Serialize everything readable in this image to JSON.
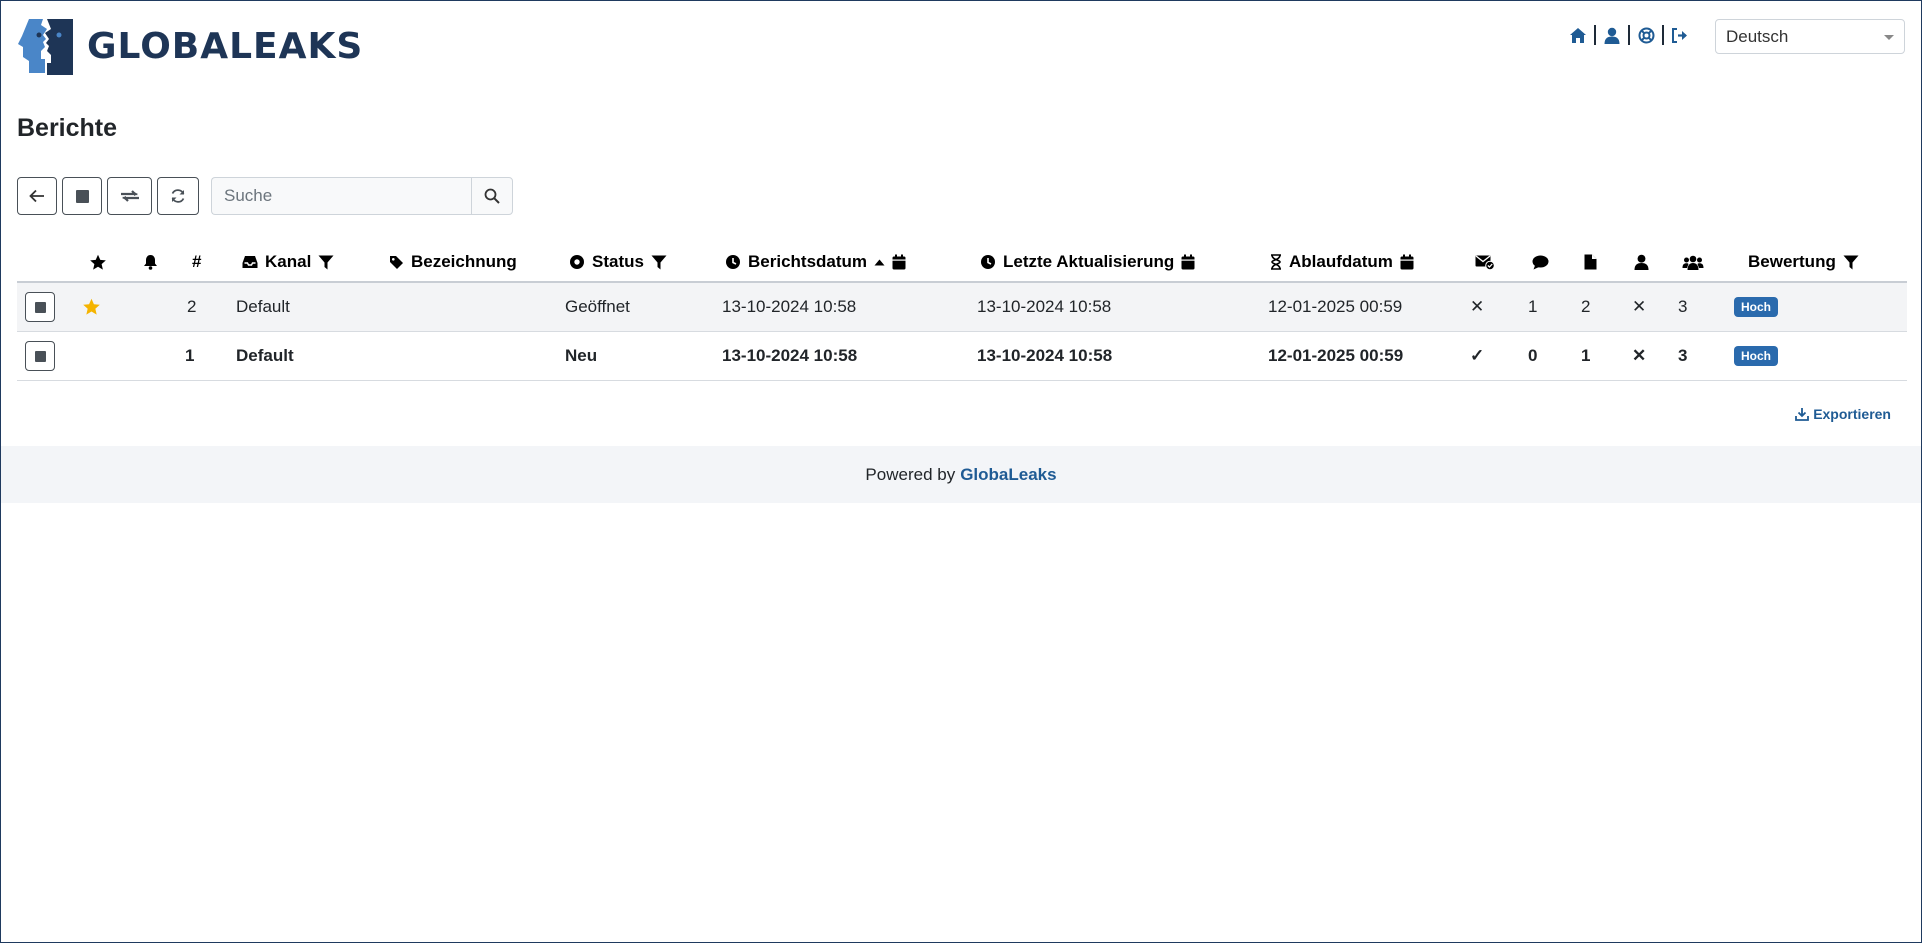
{
  "header": {
    "brand": "GLOBALEAKS",
    "nav_icons": [
      "home-icon",
      "user-icon",
      "lifebuoy-icon",
      "logout-icon"
    ],
    "language": "Deutsch"
  },
  "page_title": "Berichte",
  "toolbar": {
    "buttons": [
      "arrow-left-icon",
      "checkbox-icon",
      "transfer-icon",
      "refresh-icon"
    ],
    "search_placeholder": "Suche"
  },
  "table": {
    "columns": {
      "kanal": "Kanal",
      "bezeichnung": "Bezeichnung",
      "status": "Status",
      "berichtsdatum": "Berichtsdatum",
      "letzte": "Letzte Aktualisierung",
      "ablauf": "Ablaufdatum",
      "bewertung": "Bewertung",
      "number": "#"
    },
    "rows": [
      {
        "starred": true,
        "id": "2",
        "kanal": "Default",
        "bezeichnung": "",
        "status": "Geöffnet",
        "berichtsdatum": "13-10-2024 10:58",
        "letzte": "13-10-2024 10:58",
        "ablauf": "12-01-2025 00:59",
        "notified": "✕",
        "comments": "1",
        "files": "2",
        "assigned": "✕",
        "receivers": "3",
        "bewertung": "Hoch",
        "unread": false
      },
      {
        "starred": false,
        "id": "1",
        "kanal": "Default",
        "bezeichnung": "",
        "status": "Neu",
        "berichtsdatum": "13-10-2024 10:58",
        "letzte": "13-10-2024 10:58",
        "ablauf": "12-01-2025 00:59",
        "notified": "✓",
        "comments": "0",
        "files": "1",
        "assigned": "✕",
        "receivers": "3",
        "bewertung": "Hoch",
        "unread": true
      }
    ]
  },
  "export_label": "Exportieren",
  "footer": {
    "prefix": "Powered by",
    "link": "GlobaLeaks"
  },
  "colors": {
    "brand": "#1e3556",
    "badge": "#2a6aad",
    "link": "#1f5b94",
    "star": "#f5b400"
  }
}
